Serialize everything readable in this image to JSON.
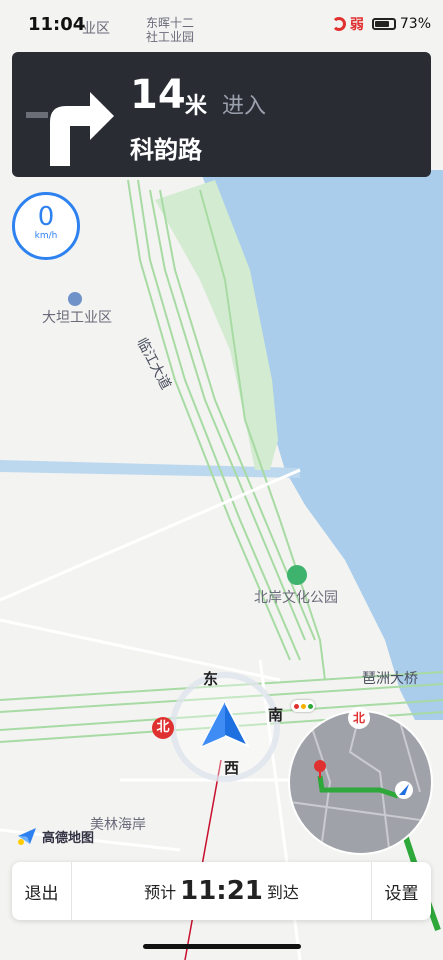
{
  "status_bar": {
    "time": "11:04",
    "signal_label": "弱",
    "battery": "73%"
  },
  "navigation": {
    "maneuver_icon": "turn-right-arrow-icon",
    "distance": "14",
    "distance_unit": "米",
    "action": "进入",
    "road": "科韵路"
  },
  "speed": {
    "value": "0",
    "unit": "km/h"
  },
  "map": {
    "labels": {
      "top_left": "业区",
      "top_center_1": "东晖十二",
      "top_center_2": "社工业园",
      "dadan": "大坦工业区",
      "linjiang": "临江大道",
      "park": "北岸文化公园",
      "pazhou_bridge": "琶洲大桥",
      "meilin": "美林海岸"
    },
    "compass": {
      "east": "东",
      "south": "南",
      "west": "西",
      "north": "北"
    },
    "mini_map_north": "北",
    "colors": {
      "water": "#a9cdea",
      "green": "#d3ebd0",
      "route": "#34b33a",
      "brand_blue": "#2d82f0",
      "alert_red": "#e03131"
    }
  },
  "branding": {
    "logo_text": "高德地图",
    "logo_icon": "amap-logo-icon"
  },
  "bottom_bar": {
    "exit_label": "退出",
    "eta_prefix": "预计",
    "eta_time": "11:21",
    "eta_suffix": "到达",
    "settings_label": "设置"
  }
}
